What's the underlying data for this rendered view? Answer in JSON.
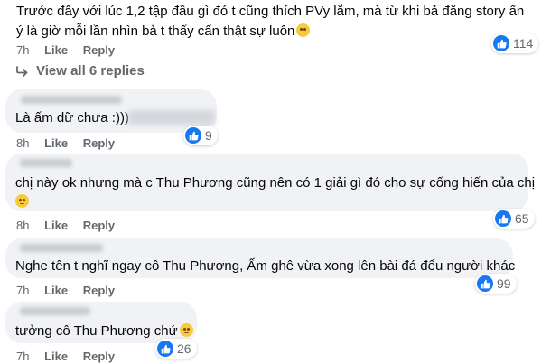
{
  "comments": [
    {
      "lines": [
        "Trước đây với lúc 1,2 tập đầu gì đó t cũng thích PVy lắm, mà từ khi bả đăng story ẩn",
        "ý là giờ mỗi lần nhìn bả t thấy cấn thật sự luôn"
      ],
      "time": "7h",
      "like": "Like",
      "reply": "Reply",
      "reactions": "114"
    },
    {
      "lines": [
        "Là ấm dữ chưa :)))"
      ],
      "time": "8h",
      "like": "Like",
      "reply": "Reply",
      "reactions": "9"
    },
    {
      "lines": [
        "chị này ok nhưng mà c Thu Phương cũng nên có 1 giải gì đó cho sự cống hiến của chị"
      ],
      "time": "8h",
      "like": "Like",
      "reply": "Reply",
      "reactions": "65"
    },
    {
      "lines": [
        "Nghe tên t nghĩ ngay cô Thu Phương, Ấm ghê vừa xong lên bài đá đểu người khác"
      ],
      "time": "7h",
      "like": "Like",
      "reply": "Reply",
      "reactions": "99"
    },
    {
      "lines": [
        "tưởng cô Thu Phương chứ"
      ],
      "time": "7h",
      "like": "Like",
      "reply": "Reply",
      "reactions": "26"
    }
  ],
  "view_replies": "View all 6 replies",
  "icons": {
    "like": "like-thumb-icon",
    "emoji": "emoji-icon",
    "arrow": "reply-arrow-icon"
  },
  "colors": {
    "like_blue": "#1877f2",
    "bubble": "#f0f2f5",
    "meta": "#65676b"
  }
}
